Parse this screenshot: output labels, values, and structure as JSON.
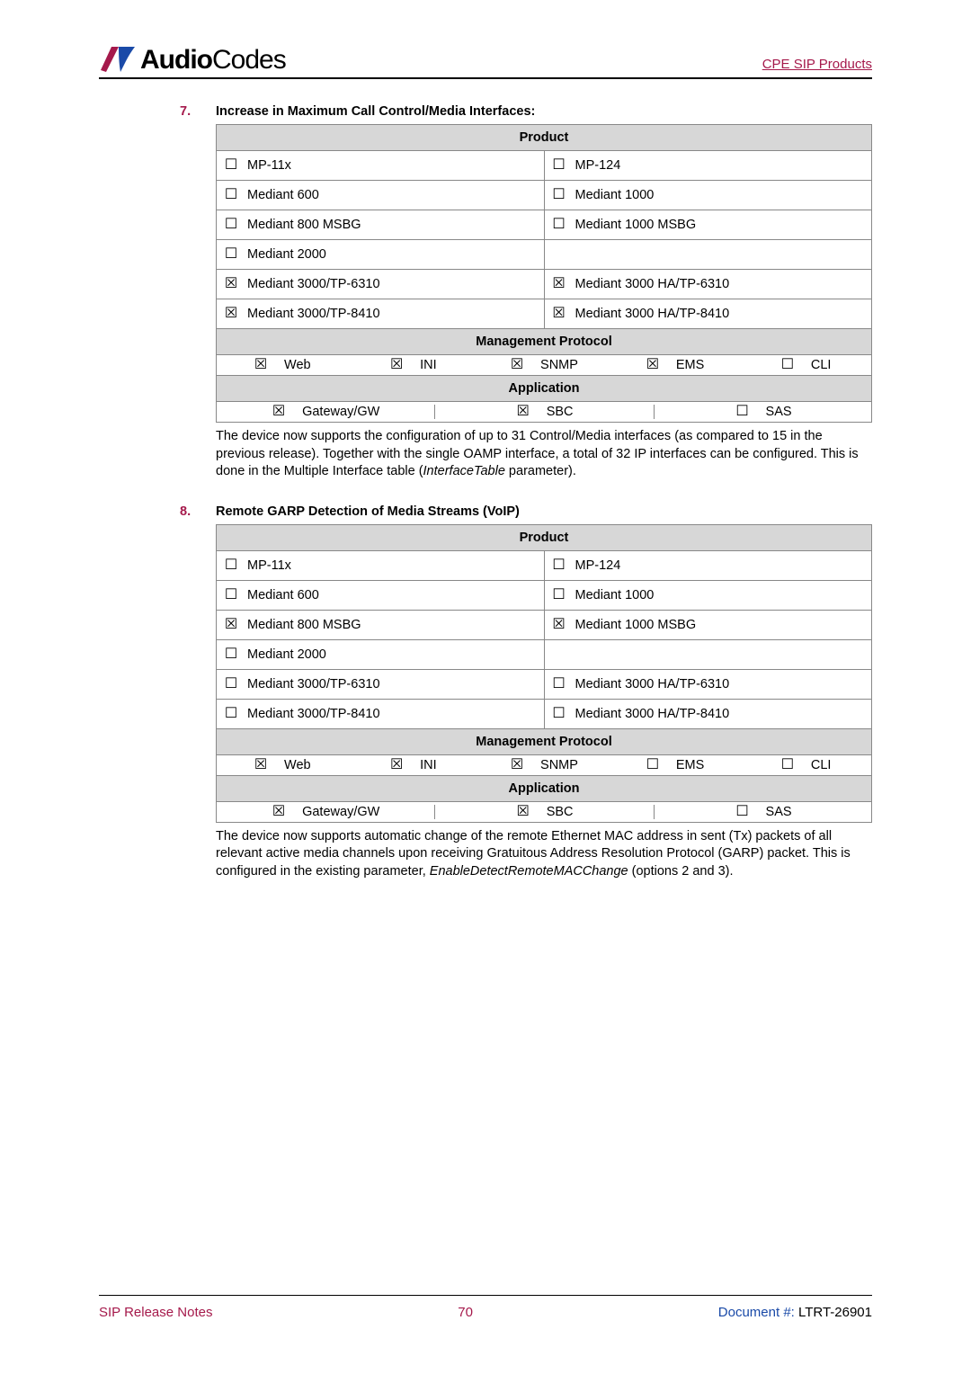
{
  "header": {
    "brand_a": "Audio",
    "brand_b": "Codes",
    "right": "CPE SIP Products"
  },
  "glyphs": {
    "unchecked": "☐",
    "checked": "☒"
  },
  "labels": {
    "product": "Product",
    "management": "Management Protocol",
    "application": "Application"
  },
  "mp_labels": {
    "web": "Web",
    "ini": "INI",
    "snmp": "SNMP",
    "ems": "EMS",
    "cli": "CLI"
  },
  "app_labels": {
    "gw": "Gateway/GW",
    "sbc": "SBC",
    "sas": "SAS"
  },
  "products": [
    {
      "l": "MP-11x",
      "r": "MP-124"
    },
    {
      "l": "Mediant 600",
      "r": "Mediant 1000"
    },
    {
      "l": "Mediant 800 MSBG",
      "r": "Mediant 1000 MSBG"
    },
    {
      "l": "Mediant 2000",
      "r": ""
    },
    {
      "l": "Mediant 3000/TP-6310",
      "r": "Mediant 3000 HA/TP-6310"
    },
    {
      "l": "Mediant 3000/TP-8410",
      "r": "Mediant 3000 HA/TP-8410"
    }
  ],
  "item7": {
    "num": "7.",
    "title": "Increase in Maximum Call Control/Media Interfaces:",
    "prod_checks": [
      {
        "l": false,
        "r": false
      },
      {
        "l": false,
        "r": false
      },
      {
        "l": false,
        "r": false
      },
      {
        "l": false,
        "r": null
      },
      {
        "l": true,
        "r": true
      },
      {
        "l": true,
        "r": true
      }
    ],
    "mp": {
      "web": true,
      "ini": true,
      "snmp": true,
      "ems": true,
      "cli": false
    },
    "app": {
      "gw": true,
      "sbc": true,
      "sas": false
    },
    "desc_a": "The device now supports the configuration of up to 31 Control/Media interfaces (as compared to 15 in the previous release). Together with the single OAMP interface, a total of 32 IP interfaces can be configured. This is done in the Multiple Interface table (",
    "desc_em": "InterfaceTable",
    "desc_b": " parameter)."
  },
  "item8": {
    "num": "8.",
    "title": "Remote GARP Detection of Media Streams (VoIP)",
    "prod_checks": [
      {
        "l": false,
        "r": false
      },
      {
        "l": false,
        "r": false
      },
      {
        "l": true,
        "r": true
      },
      {
        "l": false,
        "r": null
      },
      {
        "l": false,
        "r": false
      },
      {
        "l": false,
        "r": false
      }
    ],
    "mp": {
      "web": true,
      "ini": true,
      "snmp": true,
      "ems": false,
      "cli": false
    },
    "app": {
      "gw": true,
      "sbc": true,
      "sas": false
    },
    "desc_a": "The device now supports automatic change of the remote Ethernet MAC address in sent (Tx) packets of all relevant active media channels upon receiving Gratuitous Address Resolution Protocol (GARP) packet. This is configured in the existing parameter, ",
    "desc_em": "EnableDetectRemoteMACChange",
    "desc_b": " (options 2 and 3)."
  },
  "footer": {
    "left": "SIP Release Notes",
    "center": "70",
    "right_label": "Document #: ",
    "right_value": "LTRT-26901"
  }
}
